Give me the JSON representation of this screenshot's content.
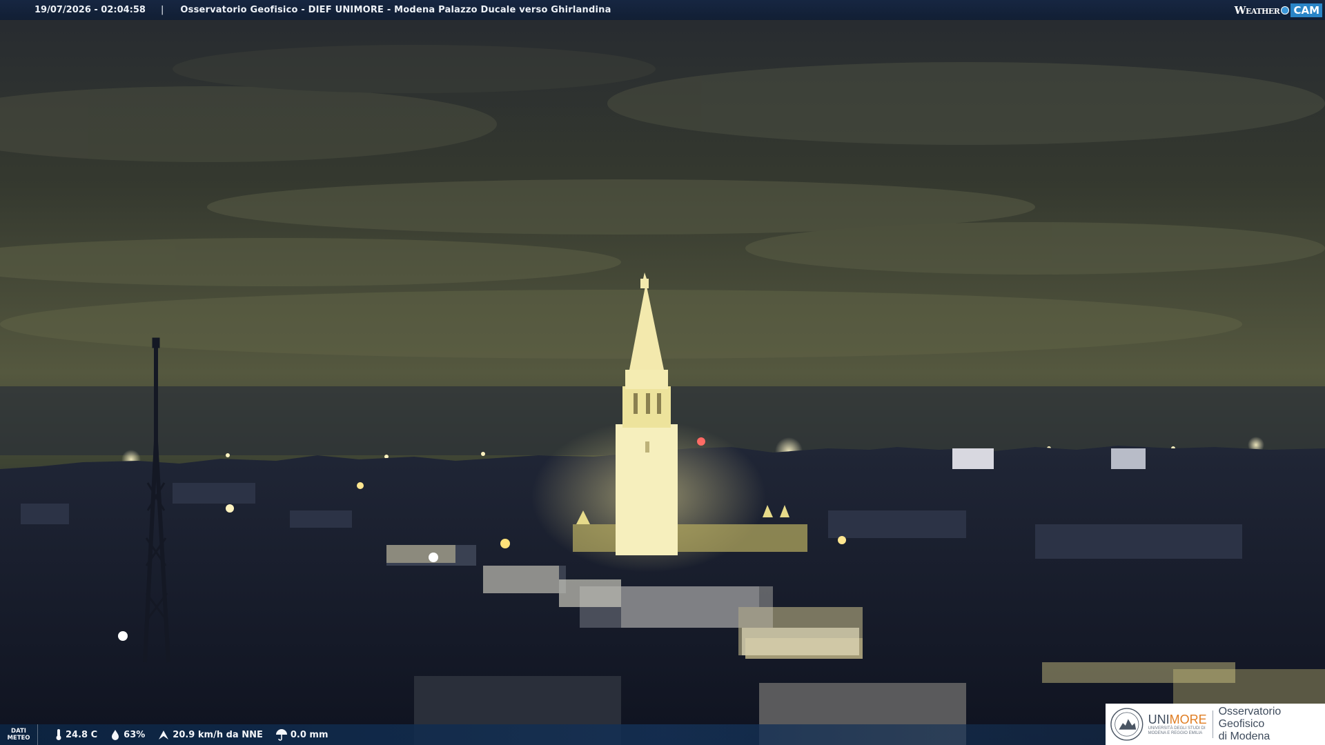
{
  "header": {
    "timestamp": "19/07/2026 - 02:04:58",
    "separator": "|",
    "caption": "Osservatorio Geofisico - DIEF UNIMORE - Modena Palazzo Ducale verso Ghirlandina",
    "brand_weather": "Weather",
    "brand_cam": "CAM"
  },
  "weather": {
    "label_line1": "DATI",
    "label_line2": "METEO",
    "temperature": "24.8 C",
    "humidity": "63%",
    "wind": "20.9 km/h da NNE",
    "rain": "0.0 mm"
  },
  "logo": {
    "uni_prefix": "UNI",
    "uni_suffix": "MORE",
    "uni_subtitle_line1": "UNIVERSITÀ DEGLI STUDI DI",
    "uni_subtitle_line2": "MODENA E REGGIO EMILIA",
    "observatory_line1": "Osservatorio Geofisico",
    "observatory_line2": "di Modena"
  },
  "colors": {
    "bar_background": "#14263f",
    "brand_blue": "#2a85c7",
    "unimore_orange": "#e07d22",
    "tower_light": "#f3ecb0"
  },
  "icons": {
    "temperature": "thermometer-icon",
    "humidity": "droplet-icon",
    "wind": "wind-icon",
    "rain": "umbrella-icon"
  }
}
